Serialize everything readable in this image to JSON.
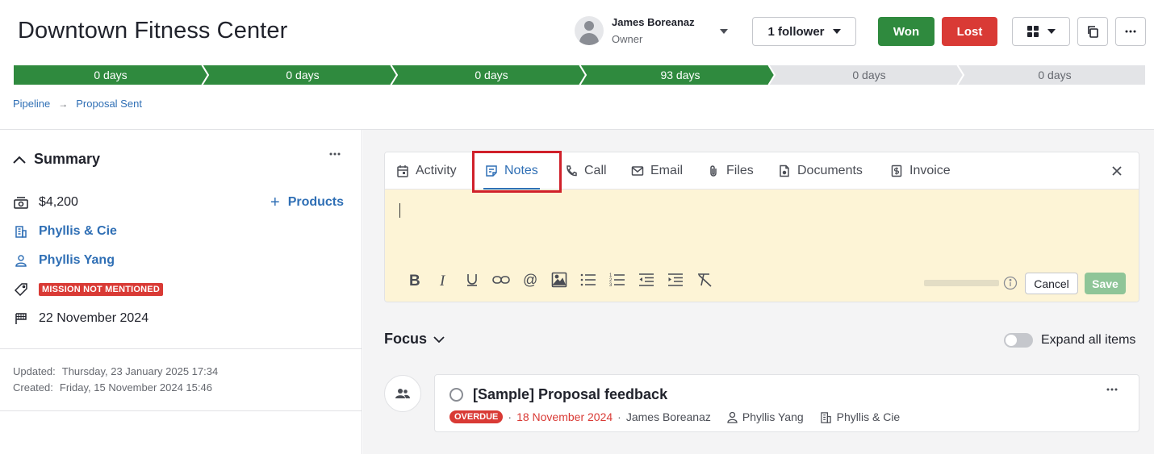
{
  "header": {
    "title": "Downtown Fitness Center",
    "owner_name": "James Boreanaz",
    "owner_role": "Owner",
    "follower_label": "1 follower",
    "won_label": "Won",
    "lost_label": "Lost"
  },
  "stages": [
    {
      "label": "0 days",
      "done": true
    },
    {
      "label": "0 days",
      "done": true
    },
    {
      "label": "0 days",
      "done": true
    },
    {
      "label": "93 days",
      "done": true
    },
    {
      "label": "0 days",
      "done": false
    },
    {
      "label": "0 days",
      "done": false
    }
  ],
  "breadcrumb": {
    "pipeline": "Pipeline",
    "arrow": "→",
    "stage": "Proposal Sent"
  },
  "summary": {
    "title": "Summary",
    "value": "$4,200",
    "products_label": "Products",
    "organization": "Phyllis & Cie",
    "person": "Phyllis Yang",
    "label_tag": "MISSION NOT MENTIONED",
    "close_date": "22 November 2024",
    "updated_label": "Updated:",
    "updated_value": "Thursday, 23 January 2025 17:34",
    "created_label": "Created:",
    "created_value": "Friday, 15 November 2024 15:46"
  },
  "composer": {
    "tabs": [
      {
        "label": "Activity",
        "icon": "calendar-icon"
      },
      {
        "label": "Notes",
        "icon": "note-icon",
        "active": true
      },
      {
        "label": "Call",
        "icon": "phone-icon"
      },
      {
        "label": "Email",
        "icon": "envelope-icon"
      },
      {
        "label": "Files",
        "icon": "paperclip-icon"
      },
      {
        "label": "Documents",
        "icon": "document-icon"
      },
      {
        "label": "Invoice",
        "icon": "invoice-icon"
      }
    ],
    "cancel_label": "Cancel",
    "save_label": "Save",
    "editor_bg": "#fdf4d6"
  },
  "focus": {
    "title": "Focus",
    "expand_label": "Expand all items",
    "activity": {
      "title": "[Sample] Proposal feedback",
      "status": "OVERDUE",
      "date": "18 November 2024",
      "owner": "James Boreanaz",
      "person": "Phyllis Yang",
      "organization": "Phyllis & Cie"
    }
  },
  "colors": {
    "accent": "#2f6fb5",
    "won": "#2f8a3e",
    "lost": "#d93a35",
    "highlight": "#d0202a"
  }
}
